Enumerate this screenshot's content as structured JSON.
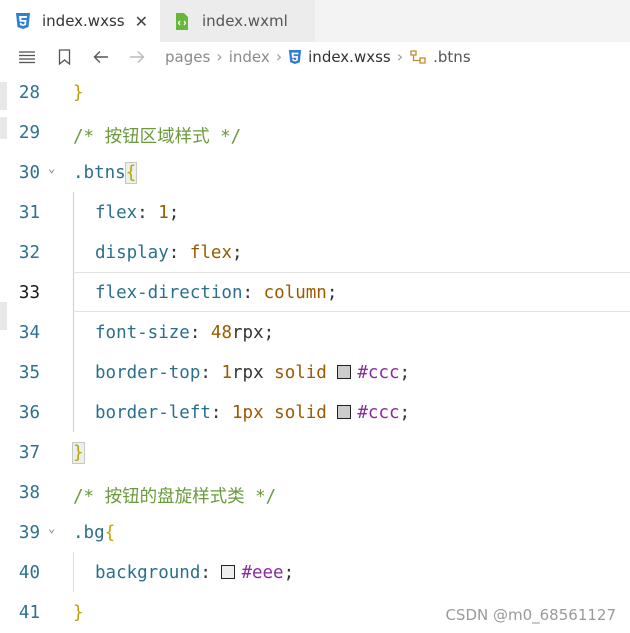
{
  "tabs": [
    {
      "label": "index.wxss",
      "active": true,
      "icon": "css3-icon"
    },
    {
      "label": "index.wxml",
      "active": false,
      "icon": "wxml-file-icon"
    }
  ],
  "breadcrumb": {
    "parts": [
      "pages",
      "index",
      "index.wxss",
      ".btns"
    ]
  },
  "lines": [
    {
      "n": "28"
    },
    {
      "n": "29",
      "comment": "/* 按钮区域样式 */"
    },
    {
      "n": "30",
      "selector": ".btns",
      "brace": "{"
    },
    {
      "n": "31",
      "prop": "flex",
      "colon": ":",
      "num": "1",
      "semi": ";"
    },
    {
      "n": "32",
      "prop": "display",
      "colon": ":",
      "val": "flex",
      "semi": ";"
    },
    {
      "n": "33",
      "prop": "flex-direction",
      "colon": ":",
      "val": "column",
      "semi": ";"
    },
    {
      "n": "34",
      "prop": "font-size",
      "colon": ":",
      "num": "48",
      "unit": "rpx",
      "semi": ";"
    },
    {
      "n": "35",
      "prop": "border-top",
      "colon": ":",
      "num": "1",
      "unit": "rpx",
      "val": "solid",
      "hash": "#ccc",
      "semi": ";"
    },
    {
      "n": "36",
      "prop": "border-left",
      "colon": ":",
      "num": "1px",
      "val": "solid",
      "hash": "#ccc",
      "semi": ";"
    },
    {
      "n": "37",
      "brace": "}"
    },
    {
      "n": "38",
      "comment": "/* 按钮的盘旋样式类 */"
    },
    {
      "n": "39",
      "selector": ".bg",
      "brace": "{"
    },
    {
      "n": "40",
      "prop": "background",
      "colon": ":",
      "hash": "#eee",
      "semi": ";"
    },
    {
      "n": "41",
      "brace": "}"
    }
  ],
  "closing_brace_28": "}",
  "swatch_colors": {
    "ccc": "#cccccc",
    "eee": "#eeeeee"
  },
  "watermark": "CSDN @m0_68561127"
}
